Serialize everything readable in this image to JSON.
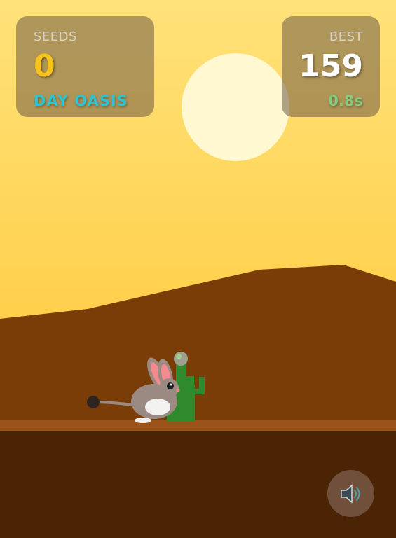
{
  "hud": {
    "seeds_label": "SEEDS",
    "seeds_value": "0",
    "zone_name": "DAY OASIS",
    "best_label": "BEST",
    "best_value": "159",
    "timer": "0.8s"
  },
  "controls": {
    "sound_icon": "speaker-icon",
    "sound_on": true
  },
  "colors": {
    "sky_top": "#ffe27a",
    "sky_bottom": "#ffc93a",
    "sun": "#fff8d0",
    "dune": "#7a3d08",
    "ground_strip": "#9a5318",
    "ground": "#4a2405",
    "cactus": "#2f8a2e",
    "jerboa_body": "#9b8a82",
    "zone_accent": "#2fc3cf",
    "seeds_accent": "#f6c21c"
  }
}
